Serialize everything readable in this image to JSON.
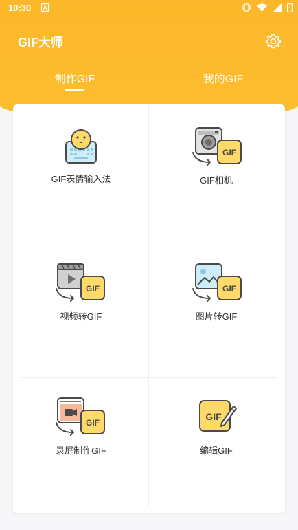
{
  "status_bar": {
    "time": "10:30"
  },
  "app": {
    "title": "GIF大师"
  },
  "tabs": [
    {
      "label": "制作GIF",
      "active": true
    },
    {
      "label": "我的GIF",
      "active": false
    }
  ],
  "tools": [
    {
      "label": "GIF表情输入法",
      "icon": "emoji-keyboard-icon"
    },
    {
      "label": "GIF相机",
      "icon": "camera-gif-icon"
    },
    {
      "label": "视频转GIF",
      "icon": "video-to-gif-icon"
    },
    {
      "label": "图片转GIF",
      "icon": "image-to-gif-icon"
    },
    {
      "label": "录屏制作GIF",
      "icon": "screen-record-gif-icon"
    },
    {
      "label": "编辑GIF",
      "icon": "edit-gif-icon"
    }
  ],
  "gif_badge_text": "GIF",
  "colors": {
    "accent": "#FDB72A",
    "icon_yellow": "#FFD96A",
    "icon_outline": "#4A4A4A",
    "icon_gray": "#C8C8C8",
    "icon_blue": "#CDEEF7",
    "icon_peach": "#F6B99A"
  }
}
